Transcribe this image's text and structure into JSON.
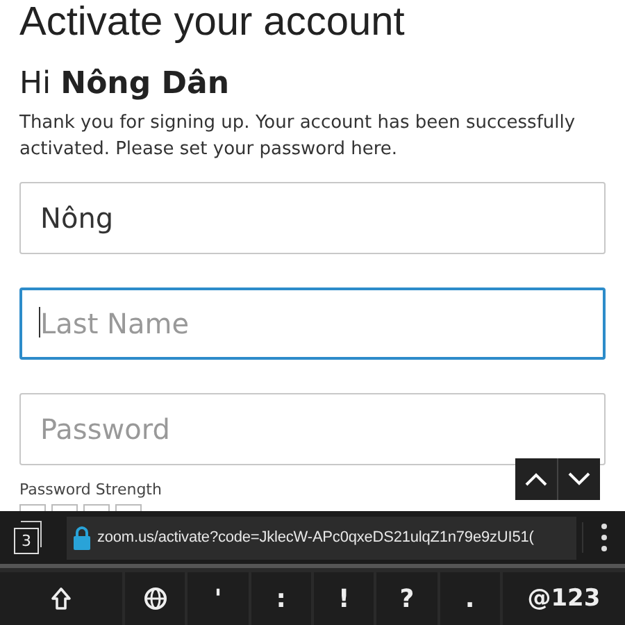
{
  "page": {
    "title": "Activate your account",
    "greeting": "Hi **Nông Dân**",
    "message": "Thank you for signing up. Your account has been successfully activated. Please set your password here.",
    "fields": [
      {
        "value": "Nông",
        "focused": false
      },
      {
        "placeholder": "Last Name",
        "focused": true
      },
      {
        "placeholder": "Password",
        "focused": false
      }
    ],
    "strength_label": "Password Strength"
  },
  "browser_bar": {
    "tab_count": "3",
    "url": "zoom.us/activate?code=JklecW-APc0qxeDS21ulqZ1n79e9zUI51("
  },
  "keyboard": {
    "keys": [
      {
        "kind": "shift"
      },
      {
        "kind": "globe"
      },
      {
        "kind": "text",
        "label": "'"
      },
      {
        "kind": "text",
        "label": ":"
      },
      {
        "kind": "text",
        "label": "!"
      },
      {
        "kind": "text",
        "label": "?"
      },
      {
        "kind": "text",
        "label": "."
      },
      {
        "kind": "wide",
        "label": "@123"
      }
    ]
  }
}
